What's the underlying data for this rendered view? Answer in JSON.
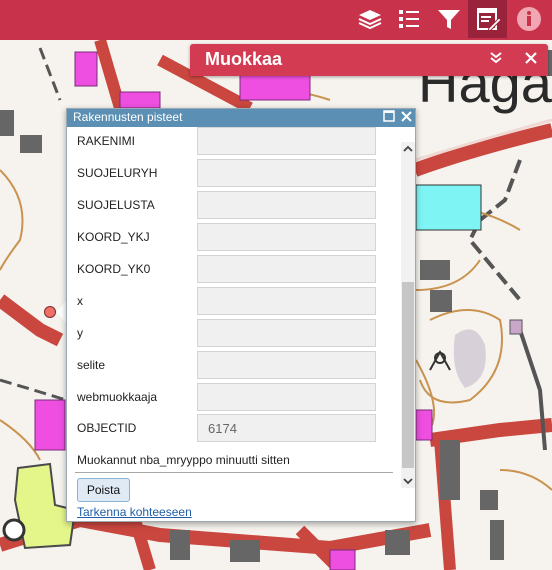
{
  "map": {
    "place_label": "Haga"
  },
  "toolbar": {
    "tools": [
      {
        "icon": "layers-icon"
      },
      {
        "icon": "legend-list-icon"
      },
      {
        "icon": "filter-icon"
      },
      {
        "icon": "edit-table-icon",
        "active": true
      },
      {
        "icon": "info-icon"
      }
    ]
  },
  "edit_panel": {
    "title": "Muokkaa",
    "collapse_icon": "chevron-double-down-icon",
    "close_icon": "close-icon"
  },
  "popup": {
    "title": "Rakennusten pisteet",
    "fields": [
      {
        "label": "RAKENIMI",
        "value": ""
      },
      {
        "label": "SUOJELURYH",
        "value": ""
      },
      {
        "label": "SUOJELUSTA",
        "value": ""
      },
      {
        "label": "KOORD_YKJ",
        "value": ""
      },
      {
        "label": "KOORD_YK0",
        "value": ""
      },
      {
        "label": "x",
        "value": ""
      },
      {
        "label": "y",
        "value": ""
      },
      {
        "label": "selite",
        "value": ""
      },
      {
        "label": "webmuokkaaja",
        "value": ""
      },
      {
        "label": "OBJECTID",
        "value": "6174"
      }
    ],
    "edited_info": "Muokannut nba_mryyppo minuutti sitten",
    "delete_label": "Poista",
    "zoom_link": "Tarkenna kohteeseen"
  },
  "colors": {
    "toolbar": "#c8324a",
    "panel_header": "#d23b52",
    "popup_header": "#5b8fb3"
  }
}
